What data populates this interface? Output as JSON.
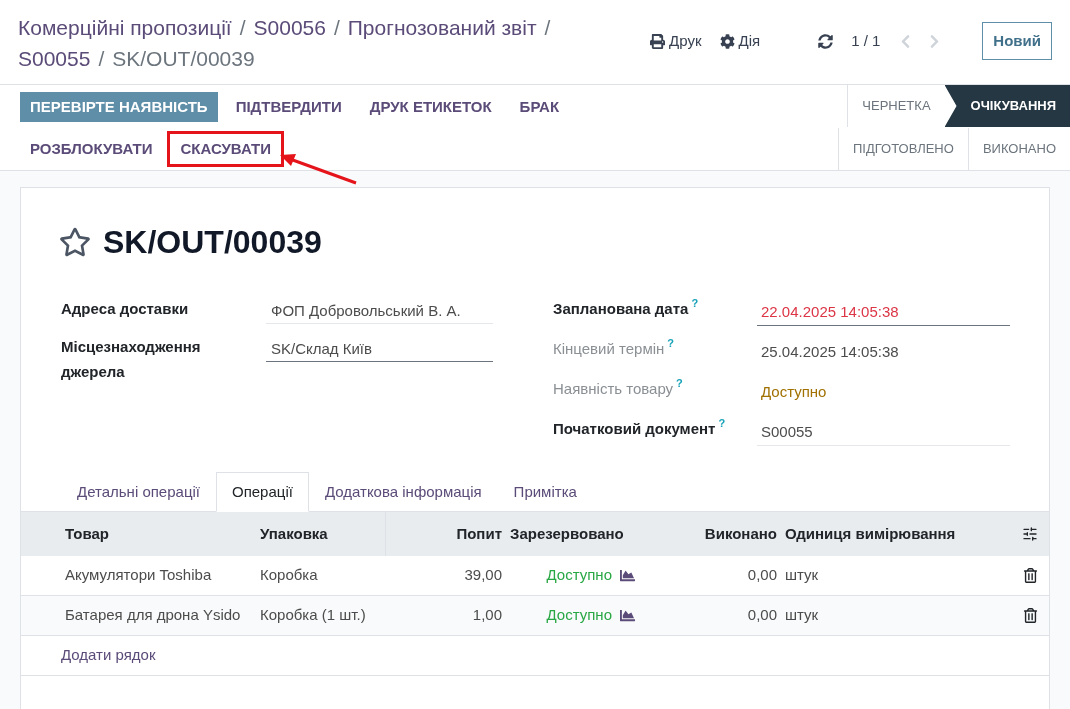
{
  "breadcrumbs": {
    "separator": "/",
    "items": [
      {
        "label": "Комерційні пропозиції",
        "current": false
      },
      {
        "label": "S00056",
        "current": false
      },
      {
        "label": "Прогнозований звіт",
        "current": false
      },
      {
        "label": "S00055",
        "current": false
      },
      {
        "label": "SK/OUT/00039",
        "current": true
      }
    ]
  },
  "toolbar": {
    "print": "Друк",
    "action": "Дія",
    "pager": "1 / 1",
    "new": "Новий"
  },
  "actions": [
    {
      "label": "ПЕРЕВІРТЕ НАЯВНІСТЬ",
      "kind": "primary",
      "highlighted": false
    },
    {
      "label": "ПІДТВЕРДИТИ",
      "kind": "link",
      "highlighted": false
    },
    {
      "label": "ДРУК ЕТИКЕТОК",
      "kind": "link",
      "highlighted": false
    },
    {
      "label": "БРАК",
      "kind": "link",
      "highlighted": false
    },
    {
      "label": "РОЗБЛОКУВАТИ",
      "kind": "link",
      "highlighted": false
    },
    {
      "label": "СКАСУВАТИ",
      "kind": "link",
      "highlighted": true
    }
  ],
  "stages": [
    {
      "label": "ЧЕРНЕТКА",
      "selected": false
    },
    {
      "label": "ОЧІКУВАННЯ",
      "selected": true
    },
    {
      "label": "ПІДГОТОВЛЕНО",
      "selected": false
    },
    {
      "label": "ВИКОНАНО",
      "selected": false
    }
  ],
  "record": {
    "title": "SK/OUT/00039",
    "starred": false
  },
  "left_fields": [
    {
      "label": "Адреса доставки",
      "value": "ФОП Добровольський В. А.",
      "editable": true
    },
    {
      "label": "Місцезнаходження джерела",
      "value": "SK/Склад Київ",
      "editable": true
    }
  ],
  "right_fields": [
    {
      "label": "Запланована дата",
      "help": "?",
      "readonly": false,
      "value": "22.04.2025 14:05:38",
      "kind": "date",
      "overdue": true,
      "editable": true
    },
    {
      "label": "Кінцевий термін",
      "help": "?",
      "readonly": true,
      "value": "25.04.2025 14:05:38",
      "kind": "date",
      "overdue": false,
      "editable": false
    },
    {
      "label": "Наявність товару",
      "help": "?",
      "readonly": true,
      "value": "Доступно",
      "kind": "status",
      "editable": false
    },
    {
      "label": "Початковий документ",
      "help": "?",
      "readonly": false,
      "value": "S00055",
      "kind": "text",
      "editable": true
    }
  ],
  "tabs": [
    {
      "label": "Детальні операції",
      "selected": false
    },
    {
      "label": "Операції",
      "selected": true
    },
    {
      "label": "Додаткова інформація",
      "selected": false
    },
    {
      "label": "Примітка",
      "selected": false
    }
  ],
  "table": {
    "columns": [
      {
        "label": "Товар",
        "numeric": false
      },
      {
        "label": "Упаковка",
        "numeric": false
      },
      {
        "label": "Попит",
        "numeric": true
      },
      {
        "label": "Зарезервовано",
        "numeric": false
      },
      {
        "label": "Виконано",
        "numeric": true
      },
      {
        "label": "Одиниця вимірювання",
        "numeric": false
      }
    ],
    "rows": [
      {
        "product": "Акумулятори Toshiba",
        "packaging": "Коробка",
        "demand": "39,00",
        "reserved": "Доступно",
        "done": "0,00",
        "uom": "штук"
      },
      {
        "product": "Батарея для дрона Ysido",
        "packaging": "Коробка (1 шт.)",
        "demand": "1,00",
        "reserved": "Доступно",
        "done": "0,00",
        "uom": "штук"
      }
    ],
    "add_line": "Додати рядок"
  }
}
